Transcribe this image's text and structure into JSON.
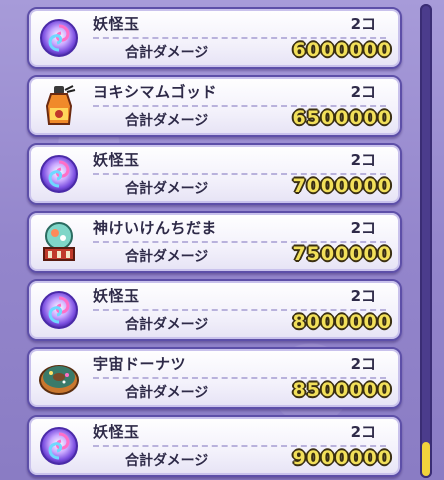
{
  "items": [
    {
      "name": "妖怪玉",
      "count": "2コ",
      "damage_label": "合計ダメージ",
      "damage": "6000000",
      "icon": "yokai-orb-icon"
    },
    {
      "name": "ヨキシマムゴッド",
      "count": "2コ",
      "damage_label": "合計ダメージ",
      "damage": "6500000",
      "icon": "yokishimamu-god-bottle-icon"
    },
    {
      "name": "妖怪玉",
      "count": "2コ",
      "damage_label": "合計ダメージ",
      "damage": "7000000",
      "icon": "yokai-orb-icon"
    },
    {
      "name": "神けいけんちだま",
      "count": "2コ",
      "damage_label": "合計ダメージ",
      "damage": "7500000",
      "icon": "god-exp-orb-icon"
    },
    {
      "name": "妖怪玉",
      "count": "2コ",
      "damage_label": "合計ダメージ",
      "damage": "8000000",
      "icon": "yokai-orb-icon"
    },
    {
      "name": "宇宙ドーナツ",
      "count": "2コ",
      "damage_label": "合計ダメージ",
      "damage": "8500000",
      "icon": "space-donut-icon"
    },
    {
      "name": "妖怪玉",
      "count": "2コ",
      "damage_label": "合計ダメージ",
      "damage": "9000000",
      "icon": "yokai-orb-icon"
    }
  ],
  "colors": {
    "background": "#9b8fd0",
    "row_border": "#5d4fa8",
    "damage_number": "#f2e05a",
    "scroll_thumb": "#f1d23c"
  }
}
